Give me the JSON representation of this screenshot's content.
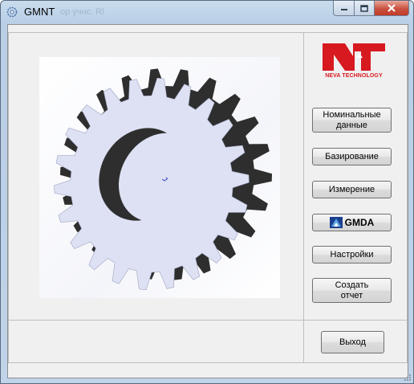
{
  "window": {
    "title": "GMNT",
    "ghost_title": "ор учнс. Rl"
  },
  "logo": {
    "text": "NEVA TECHNOLOGY",
    "color": "#d71920"
  },
  "buttons": {
    "nominal": "Номинальные\nданные",
    "basing": "Базирование",
    "measure": "Измерение",
    "gmda": "GMDA",
    "settings": "Настройки",
    "report": "Создать\nотчет",
    "exit": "Выход"
  },
  "colors": {
    "gear_face": "#dde1f3",
    "gear_side": "#2e2e2e",
    "titlebar": "#c4d7ec"
  }
}
